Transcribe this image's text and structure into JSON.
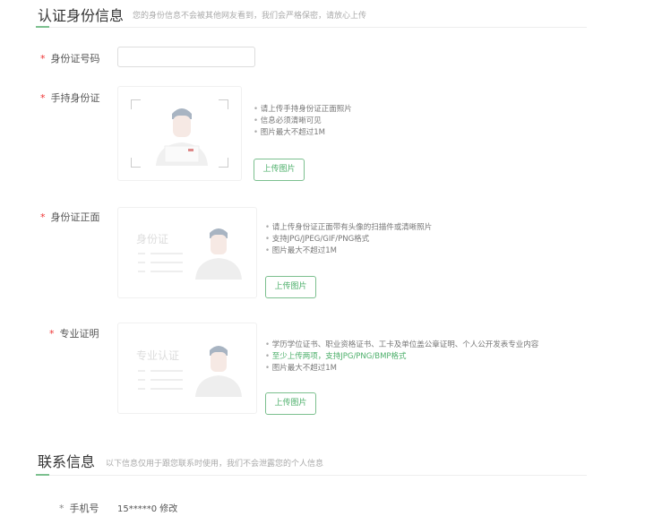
{
  "identity_section": {
    "title": "认证身份信息",
    "subtitle": "您的身份信息不会被其他网友看到，我们会严格保密，请放心上传"
  },
  "fields": {
    "id_number": {
      "required": "*",
      "label": "身份证号码",
      "value": "",
      "placeholder": ""
    },
    "handheld_id": {
      "required": "*",
      "label": "手持身份证",
      "tips": [
        "请上传手持身份证正面照片",
        "信息必须清晰可见",
        "图片最大不超过1M"
      ],
      "button": "上传图片"
    },
    "id_front": {
      "required": "*",
      "label": "身份证正面",
      "card_text": "身份证",
      "tips": [
        "请上传身份证正面带有头像的扫描件或清晰照片",
        "支持JPG/JPEG/GIF/PNG格式",
        "图片最大不超过1M"
      ],
      "button": "上传图片"
    },
    "professional_cert": {
      "required": "*",
      "label": "专业证明",
      "card_text": "专业认证",
      "tips": [
        "学历学位证书、职业资格证书、工卡及单位盖公章证明、个人公开发表专业内容",
        "至少上传两项，支持JPG/PNG/BMP格式",
        "图片最大不超过1M"
      ],
      "button": "上传图片"
    }
  },
  "contact_section": {
    "title": "联系信息",
    "subtitle": "以下信息仅用于跟您联系时使用，我们不会泄露您的个人信息"
  },
  "phone": {
    "required": "*",
    "label": "手机号",
    "value": "15*****0",
    "edit_link": "修改"
  },
  "colors": {
    "accent": "#4caf6a",
    "required": "#e33333"
  }
}
